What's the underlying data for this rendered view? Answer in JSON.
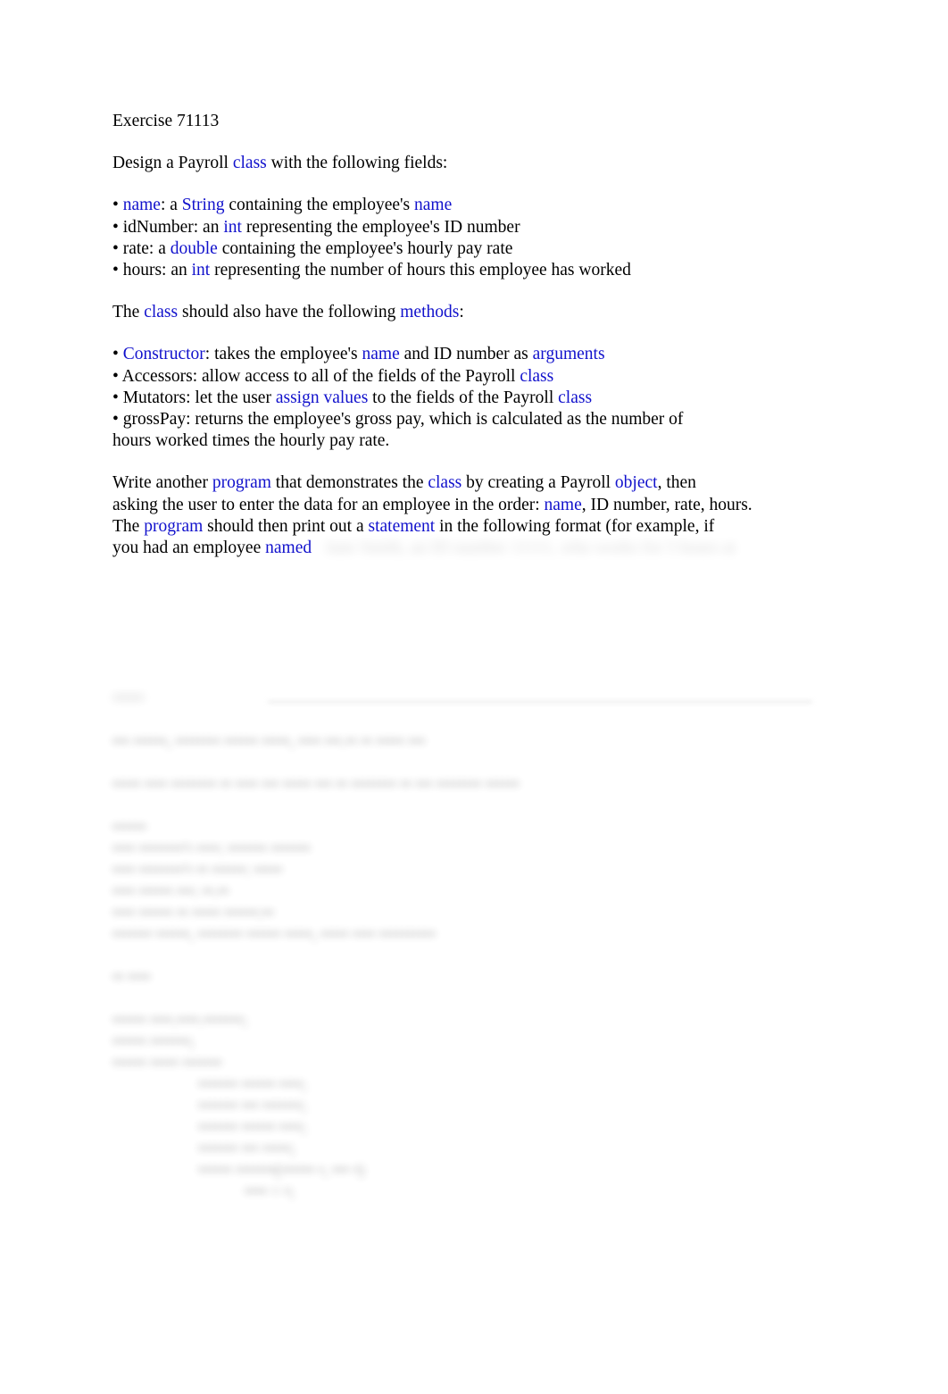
{
  "document": {
    "title": "Exercise 71113",
    "heading": "Exercise 71113",
    "intro": {
      "pre": "Design a Payroll ",
      "kw": "class",
      "post": " with the following fields:"
    },
    "fields": [
      {
        "bullet": "• ",
        "segments": [
          {
            "text": "name",
            "kw": true
          },
          {
            "text": ": a ",
            "kw": false
          },
          {
            "text": "String",
            "kw": true
          },
          {
            "text": " containing the employee's ",
            "kw": false
          },
          {
            "text": "name",
            "kw": true
          }
        ]
      },
      {
        "bullet": "• ",
        "segments": [
          {
            "text": "idNumber: an ",
            "kw": false
          },
          {
            "text": "int",
            "kw": true
          },
          {
            "text": " representing the employee's ID number",
            "kw": false
          }
        ]
      },
      {
        "bullet": "• ",
        "segments": [
          {
            "text": "rate: a ",
            "kw": false
          },
          {
            "text": "double",
            "kw": true
          },
          {
            "text": " containing the employee's hourly pay rate",
            "kw": false
          }
        ]
      },
      {
        "bullet": "• ",
        "segments": [
          {
            "text": "hours: an ",
            "kw": false
          },
          {
            "text": "int",
            "kw": true
          },
          {
            "text": " representing the number of hours this employee has worked",
            "kw": false
          }
        ]
      }
    ],
    "methods_intro": {
      "segments": [
        {
          "text": "The ",
          "kw": false
        },
        {
          "text": "class",
          "kw": true
        },
        {
          "text": " should also have the following ",
          "kw": false
        },
        {
          "text": "methods",
          "kw": true
        },
        {
          "text": ":",
          "kw": false
        }
      ]
    },
    "methods": [
      {
        "bullet": "• ",
        "segments": [
          {
            "text": "Constructor",
            "kw": true
          },
          {
            "text": ": takes the employee's ",
            "kw": false
          },
          {
            "text": "name",
            "kw": true
          },
          {
            "text": " and ID number as ",
            "kw": false
          },
          {
            "text": "arguments",
            "kw": true
          }
        ]
      },
      {
        "bullet": "• ",
        "segments": [
          {
            "text": "Accessors: allow access to all of the fields of the Payroll ",
            "kw": false
          },
          {
            "text": "class",
            "kw": true
          }
        ]
      },
      {
        "bullet": "• ",
        "segments": [
          {
            "text": "Mutators: let the user ",
            "kw": false
          },
          {
            "text": "assign values",
            "kw": true
          },
          {
            "text": " to the fields of the Payroll ",
            "kw": false
          },
          {
            "text": "class",
            "kw": true
          }
        ]
      },
      {
        "bullet": "• ",
        "segments": [
          {
            "text": "grossPay: returns the employee's gross pay, which is calculated as the number of",
            "kw": false
          }
        ]
      },
      {
        "bullet": "",
        "segments": [
          {
            "text": "hours worked times the hourly pay rate.",
            "kw": false
          }
        ]
      }
    ],
    "closing": [
      {
        "segments": [
          {
            "text": "Write another ",
            "kw": false
          },
          {
            "text": "program",
            "kw": true
          },
          {
            "text": " that demonstrates the ",
            "kw": false
          },
          {
            "text": "class",
            "kw": true
          },
          {
            "text": " by creating a Payroll ",
            "kw": false
          },
          {
            "text": "object",
            "kw": true
          },
          {
            "text": ", then",
            "kw": false
          }
        ]
      },
      {
        "segments": [
          {
            "text": "asking the user to enter the data for an employee in the order: ",
            "kw": false
          },
          {
            "text": "name",
            "kw": true
          },
          {
            "text": ", ID number, rate, hours.",
            "kw": false
          }
        ]
      },
      {
        "segments": [
          {
            "text": "The ",
            "kw": false
          },
          {
            "text": "program",
            "kw": true
          },
          {
            "text": " should then print out a ",
            "kw": false
          },
          {
            "text": "statement",
            "kw": true
          },
          {
            "text": " in the following format (for example, if",
            "kw": false
          }
        ]
      },
      {
        "segments": [
          {
            "text": "you had an employee ",
            "kw": false
          },
          {
            "text": "named",
            "kw": true
          }
        ]
      }
    ]
  },
  "lower_region": {
    "note": "illegible",
    "label": "••••••",
    "lines": [
      "••• ••••••, •••••••• •••••• •••••, •••• •••.•• •• ••••• •••",
      "••••• •••• •••••••• •• •••• ••• ••••• ••• •• •••••••• •• ••• •••••••• ••••••"
    ],
    "output_label": "••••••",
    "output_lines": [
      "•••• ••••••••'• ••••: ••••••• •••••••",
      "•••• ••••••••'• •• ••••••: •••••",
      "•••• •••••• •••: ••.••",
      "•••• •••••• •• ••••• ••••••:••",
      "••••••• ••••••, •••••••• •••••• •••••, ••••• •••• ••••••••••"
    ],
    "code_label": "•• ••••",
    "code_lines": [
      {
        "indent": 0,
        "text": "•••••• ••••.••••.•••••••;"
      },
      {
        "indent": 0,
        "text": "•••••• •••••••;"
      },
      {
        "indent": 0,
        "text": "•••••• ••••• •••••••"
      },
      {
        "indent": 2,
        "text": "••••••• •••••• ••••;"
      },
      {
        "indent": 2,
        "text": "••••••• ••• •••••••;"
      },
      {
        "indent": 2,
        "text": "••••••• •••••• ••••;"
      },
      {
        "indent": 2,
        "text": "••••••• ••• •••••;"
      },
      {
        "indent": 2,
        "text": ""
      },
      {
        "indent": 2,
        "text": "•••••• •••••••(•••••• •, ••• •)"
      },
      {
        "indent": 3,
        "text": "•••• = •;"
      }
    ]
  }
}
